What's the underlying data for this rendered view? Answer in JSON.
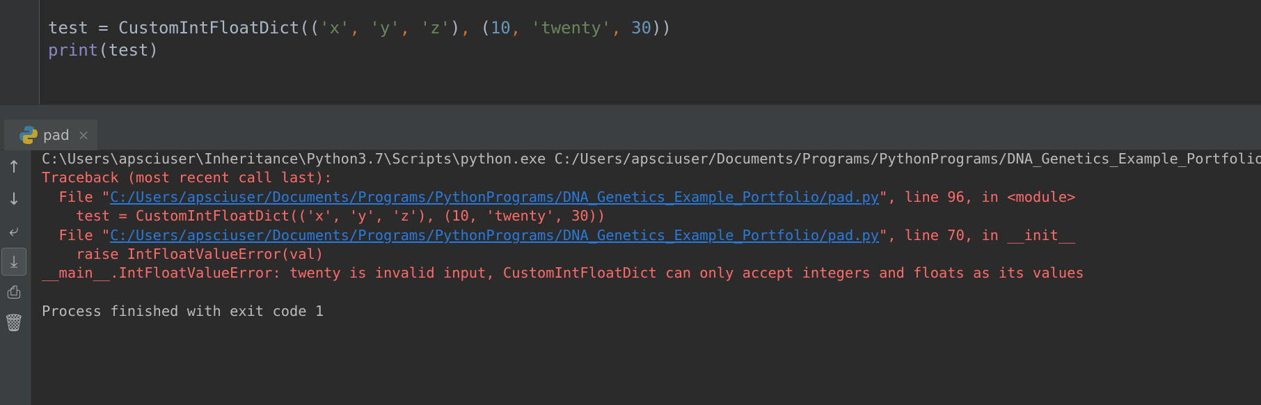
{
  "editor": {
    "line1": {
      "var": "test",
      "op": " = ",
      "cls": "CustomIntFloatDict",
      "p1": "((",
      "s1": "'x'",
      "c1": ", ",
      "s2": "'y'",
      "c2": ", ",
      "s3": "'z'",
      "p2": ")",
      "c3": ", ",
      "p3": "(",
      "n1": "10",
      "c4": ", ",
      "s4": "'twenty'",
      "c5": ", ",
      "n2": "30",
      "p4": "))"
    },
    "line2": {
      "fn": "print",
      "rest": "(test)"
    }
  },
  "run_tab": {
    "label": "pad",
    "close": "×"
  },
  "toolbar": {
    "up": "↑",
    "down": "↓",
    "wrap": "⤶",
    "scroll_end": "⤓",
    "print": "⎙",
    "trash": "🗑"
  },
  "console": {
    "command": "C:\\Users\\apsciuser\\Inheritance\\Python3.7\\Scripts\\python.exe C:/Users/apsciuser/Documents/Programs/PythonPrograms/DNA_Genetics_Example_Portfolio/pad.py",
    "traceback": "Traceback (most recent call last):",
    "frame1_prefix": "  File \"",
    "frame1_link": "C:/Users/apsciuser/Documents/Programs/PythonPrograms/DNA_Genetics_Example_Portfolio/pad.py",
    "frame1_suffix": "\", line 96, in <module>",
    "frame1_code": "    test = CustomIntFloatDict(('x', 'y', 'z'), (10, 'twenty', 30))",
    "frame2_prefix": "  File \"",
    "frame2_link": "C:/Users/apsciuser/Documents/Programs/PythonPrograms/DNA_Genetics_Example_Portfolio/pad.py",
    "frame2_suffix": "\", line 70, in __init__",
    "frame2_code": "    raise IntFloatValueError(val)",
    "error": "__main__.IntFloatValueError: twenty is invalid input, CustomIntFloatDict can only accept integers and floats as its values",
    "exit": "Process finished with exit code 1"
  }
}
